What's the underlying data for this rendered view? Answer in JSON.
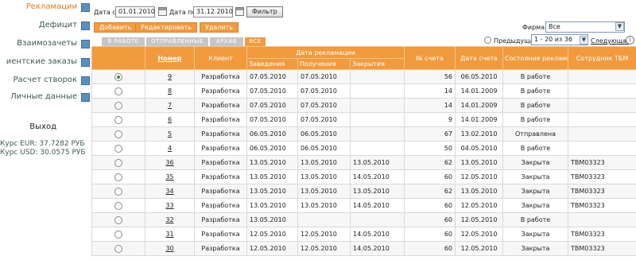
{
  "sidebar": {
    "items": [
      {
        "label": "Рекламации",
        "active": true
      },
      {
        "label": "Дефицит"
      },
      {
        "label": "Взаимозачеты"
      },
      {
        "label": "иентские заказы"
      },
      {
        "label": "Расчет створок"
      },
      {
        "label": "Личные данные"
      }
    ],
    "logout": "Выход",
    "rate_eur": "Курс EUR: 37.7282 РУБ",
    "rate_usd": "Курс USD: 30.0575 РУБ"
  },
  "filter": {
    "date_from_label": "Дата с:",
    "date_from": "01.01.2010",
    "date_to_label": "Дата по:",
    "date_to": "31.12.2010",
    "filter_button": "Фильтр"
  },
  "actions": {
    "add": "Добавить",
    "edit": "Редактировать",
    "delete": "Удалить"
  },
  "firm": {
    "label": "Фирма:",
    "value": "Все"
  },
  "pager": {
    "prev": "Предыдущая",
    "range": "1 - 20 из 36",
    "next": "Следующая"
  },
  "tabs": [
    {
      "label": "В РАБОТЕ"
    },
    {
      "label": "ОТПРАВЛЕННЫЕ"
    },
    {
      "label": "АРХИВ"
    },
    {
      "label": "ВСЕ",
      "active": true
    }
  ],
  "table": {
    "headers": {
      "number": "Номер",
      "client": "Клиент",
      "claim_date_group": "Дата рекламации",
      "created": "Заведения",
      "received": "Получения",
      "closed": "Закрытия",
      "invoice_no": "№ счета",
      "invoice_date": "Дата счета",
      "status": "Состояние рекламации",
      "employee": "Сотрудник ТБМ"
    },
    "rows": [
      {
        "selected": true,
        "number": "9",
        "client": "Разработка",
        "created": "07.05.2010",
        "received": "07.05.2010",
        "closed": "",
        "invoice_no": "56",
        "invoice_date": "06.05.2010",
        "status": "В работе",
        "employee": ""
      },
      {
        "number": "8",
        "client": "Разработка",
        "created": "07.05.2010",
        "received": "07.05.2010",
        "closed": "",
        "invoice_no": "14",
        "invoice_date": "14.01.2009",
        "status": "В работе",
        "employee": ""
      },
      {
        "number": "7",
        "client": "Разработка",
        "created": "07.05.2010",
        "received": "07.05.2010",
        "closed": "",
        "invoice_no": "14",
        "invoice_date": "14.01.2009",
        "status": "В работе",
        "employee": ""
      },
      {
        "number": "6",
        "client": "Разработка",
        "created": "07.05.2010",
        "received": "07.05.2010",
        "closed": "",
        "invoice_no": "9",
        "invoice_date": "14.01.2009",
        "status": "В работе",
        "employee": ""
      },
      {
        "number": "5",
        "client": "Разработка",
        "created": "06.05.2010",
        "received": "06.05.2010",
        "closed": "",
        "invoice_no": "67",
        "invoice_date": "13.02.2010",
        "status": "Отправлена",
        "employee": ""
      },
      {
        "number": "4",
        "client": "Разработка",
        "created": "06.05.2010",
        "received": "06.05.2010",
        "closed": "",
        "invoice_no": "50",
        "invoice_date": "04.05.2010",
        "status": "В работе",
        "employee": ""
      },
      {
        "number": "36",
        "client": "Разработка",
        "created": "13.05.2010",
        "received": "13.05.2010",
        "closed": "13.05.2010",
        "invoice_no": "62",
        "invoice_date": "13.05.2010",
        "status": "Закрыта",
        "employee": "ТВМ03323"
      },
      {
        "number": "35",
        "client": "Разработка",
        "created": "13.05.2010",
        "received": "13.05.2010",
        "closed": "14.05.2010",
        "invoice_no": "60",
        "invoice_date": "12.05.2010",
        "status": "Закрыта",
        "employee": "ТВМ03323"
      },
      {
        "number": "34",
        "client": "Разработка",
        "created": "13.05.2010",
        "received": "13.05.2010",
        "closed": "13.05.2010",
        "invoice_no": "62",
        "invoice_date": "13.05.2010",
        "status": "Закрыта",
        "employee": "ТВМ03323"
      },
      {
        "number": "33",
        "client": "Разработка",
        "created": "13.05.2010",
        "received": "13.05.2010",
        "closed": "14.05.2010",
        "invoice_no": "60",
        "invoice_date": "12.05.2010",
        "status": "Закрыта",
        "employee": "ТВМ03323"
      },
      {
        "number": "32",
        "client": "Разработка",
        "created": "13.05.2010",
        "received": "",
        "closed": "",
        "invoice_no": "60",
        "invoice_date": "12.05.2010",
        "status": "В работе",
        "employee": ""
      },
      {
        "number": "31",
        "client": "Разработка",
        "created": "12.05.2010",
        "received": "12.05.2010",
        "closed": "14.05.2010",
        "invoice_no": "60",
        "invoice_date": "12.05.2010",
        "status": "Закрыта",
        "employee": "ТВМ03323"
      },
      {
        "number": "30",
        "client": "Разработка",
        "created": "12.05.2010",
        "received": "12.05.2010",
        "closed": "14.05.2010",
        "invoice_no": "60",
        "invoice_date": "12.05.2010",
        "status": "Закрыта",
        "employee": "ТВМ03323"
      }
    ]
  }
}
